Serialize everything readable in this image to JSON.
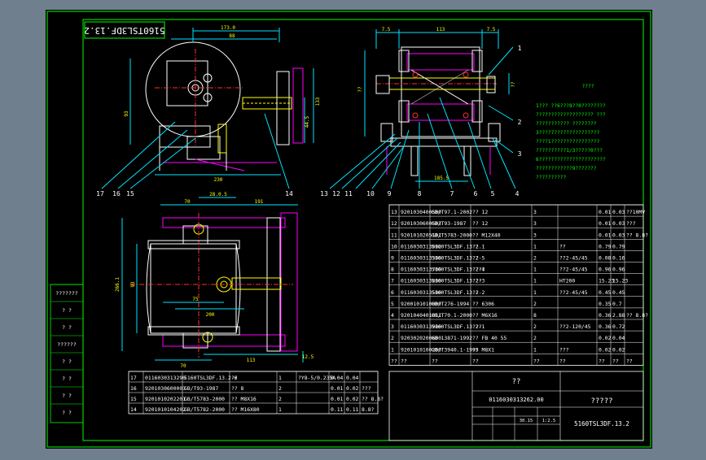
{
  "drawing": {
    "title_stamp": "5160TSL3DF.13.2",
    "drawing_no": "0116030313262.00",
    "product_code": "5160TSL3DF.13.2",
    "company": "?????",
    "drawing_name": "??",
    "scale": "1:2.5",
    "sheet": "30.15"
  },
  "notes": {
    "heading": "????",
    "lines": [
      "1??? ??6???8??0????????",
      "??????????????????? ???",
      "???????????  ????????",
      "3????7???????????????",
      "  ????1????????????????",
      "  ??????????1/3?????0???",
      "6??????????????????????",
      "  ????????????9???????",
      "  ??????????"
    ]
  },
  "views": {
    "top_dims": [
      "173.0",
      "88",
      "7.5",
      "113",
      "7.5"
    ],
    "side_dims": [
      "93",
      "133",
      "44.5",
      "??",
      "??"
    ],
    "bottom_dims": [
      "230",
      "12.5",
      "185.5"
    ],
    "plan_dims": [
      "70",
      "28.0.5",
      "191",
      "75",
      "200",
      "70",
      "113"
    ],
    "plan_side": [
      "266.1",
      "93"
    ],
    "callouts_left": [
      "17",
      "16",
      "15",
      "14"
    ],
    "callouts_mid": [
      "13",
      "12",
      "11",
      "10",
      "9",
      "8",
      "7",
      "6",
      "5",
      "4"
    ],
    "callouts_right": [
      "1",
      "2",
      "3"
    ]
  },
  "bom_main": [
    [
      "13",
      "9201030400500",
      "GB/T97.1-2002",
      "?? 12",
      "3",
      "",
      "0.01",
      "0.03",
      "??10MV"
    ],
    [
      "12",
      "9201030600503",
      "GB/T93-1987",
      "?? 12",
      "3",
      "",
      "0.01",
      "0.03",
      "???"
    ],
    [
      "11",
      "9201010205101",
      "GB/T5783-2000",
      "?? M12X40",
      "3",
      "",
      "0.01",
      "0.03",
      "?? 8.8?"
    ],
    [
      "10",
      "0116030313002",
      "5160TSL3DF.13.2.1",
      "??",
      "1",
      "??",
      "0.79",
      "0.79",
      ""
    ],
    [
      "9",
      "0116030313300",
      "5160TSL3DF.13.2-5",
      "??",
      "2",
      "??2-45/45",
      "0.08",
      "0.16",
      ""
    ],
    [
      "8",
      "0116030313700",
      "5160TSL3DF.13.2-4",
      "????",
      "1",
      "??2-45/45",
      "0.96",
      "0.96",
      ""
    ],
    [
      "7",
      "0116030313800",
      "5160TSL3DF.13.2-3",
      "???",
      "1",
      "HT200",
      "15.23",
      "15.23",
      ""
    ],
    [
      "6",
      "0116030313500",
      "5160TSL3DF.13.2-2",
      "??",
      "1",
      "??2-45/45",
      "0.45",
      "0.45",
      ""
    ],
    [
      "5",
      "9200101010000",
      "GB/T276-1994",
      "?? 6306",
      "2",
      "",
      "0.35",
      "0.7",
      ""
    ],
    [
      "4",
      "9201040401011",
      "GB/T70.1-2000",
      "?? M6X16",
      "8",
      "",
      "0.36",
      "2.88",
      "?? 8.8?"
    ],
    [
      "3",
      "0116030313900",
      "5160TSL3DF.13.2-1",
      "???",
      "2",
      "??2-120/45",
      "0.36",
      "0.72",
      ""
    ],
    [
      "2",
      "9203020200600",
      "GB 13871-1992",
      "?? FB 40 55",
      "2",
      "",
      "0.02",
      "0.04",
      ""
    ],
    [
      "1",
      "9201010100200",
      "GB/T3940.1-1995",
      "?? M8X1",
      "1",
      "???",
      "0.02",
      "0.02",
      ""
    ]
  ],
  "bom_main_header": [
    "??",
    "??",
    "??",
    "??",
    "??",
    "??",
    "??",
    "??",
    "??"
  ],
  "bom_lower": [
    [
      "17",
      "0116030313290",
      "5160TSL3DF.13.2-6",
      "??",
      "1",
      "?Y8-5/0.235A",
      "0.04",
      "0.04",
      ""
    ],
    [
      "16",
      "9201030600003",
      "GB/T93-1987",
      "?? 8",
      "2",
      "",
      "0.01",
      "0.02",
      "???"
    ],
    [
      "15",
      "9201010202201",
      "GB/T5783-2000",
      "?? M8X16",
      "2",
      "",
      "0.01",
      "0.02",
      "?? 8.8?"
    ],
    [
      "14",
      "9201010104202",
      "GB/T5782-2000",
      "?? M16X80",
      "1",
      "",
      "0.11",
      "0.11",
      "8.8?"
    ]
  ],
  "side_stack": [
    "???????",
    "? ?",
    "? ?",
    "??????",
    "? ?",
    "? ?",
    "? ?",
    "? ?"
  ],
  "colors": {
    "frame": "#00ff00",
    "canvas": "#000000",
    "outline": "#ffffff",
    "dimension": "#00e5ff",
    "hidden": "#ff00ff",
    "bolt": "#ffff00",
    "red_center": "#ff3030"
  }
}
